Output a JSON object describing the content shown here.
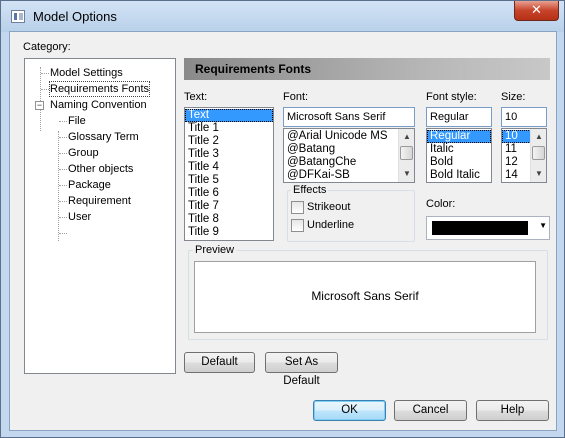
{
  "window": {
    "title": "Model Options",
    "close_glyph": "✕"
  },
  "category": {
    "label": "Category:",
    "tree": [
      {
        "label": "Model Settings"
      },
      {
        "label": "Requirements Fonts"
      },
      {
        "label": "Naming Convention",
        "expander": "−"
      },
      {
        "label": "File"
      },
      {
        "label": "Glossary Term"
      },
      {
        "label": "Group"
      },
      {
        "label": "Other objects"
      },
      {
        "label": "Package"
      },
      {
        "label": "Requirement"
      },
      {
        "label": "User"
      }
    ]
  },
  "panel": {
    "title": "Requirements Fonts"
  },
  "text": {
    "label": "Text:",
    "items": [
      "Text",
      "Title 1",
      "Title 2",
      "Title 3",
      "Title 4",
      "Title 5",
      "Title 6",
      "Title 7",
      "Title 8",
      "Title 9"
    ],
    "selected": "Text"
  },
  "font": {
    "label": "Font:",
    "value": "Microsoft Sans Serif",
    "items": [
      "@Arial Unicode MS",
      "@Batang",
      "@BatangChe",
      "@DFKai-SB"
    ]
  },
  "font_style": {
    "label": "Font style:",
    "value": "Regular",
    "items": [
      "Regular",
      "Italic",
      "Bold",
      "Bold Italic"
    ]
  },
  "size": {
    "label": "Size:",
    "value": "10",
    "items": [
      "10",
      "11",
      "12",
      "14"
    ]
  },
  "effects": {
    "label": "Effects",
    "strikeout": "Strikeout",
    "underline": "Underline"
  },
  "color": {
    "label": "Color:",
    "value": "#000000"
  },
  "preview": {
    "label": "Preview",
    "sample": "Microsoft Sans Serif"
  },
  "buttons": {
    "default": "Default",
    "set_as_default": "Set As Default",
    "ok": "OK",
    "cancel": "Cancel",
    "help": "Help"
  },
  "icons": {
    "scroll_up": "▲",
    "scroll_down": "▼",
    "dropdown": "▼"
  }
}
